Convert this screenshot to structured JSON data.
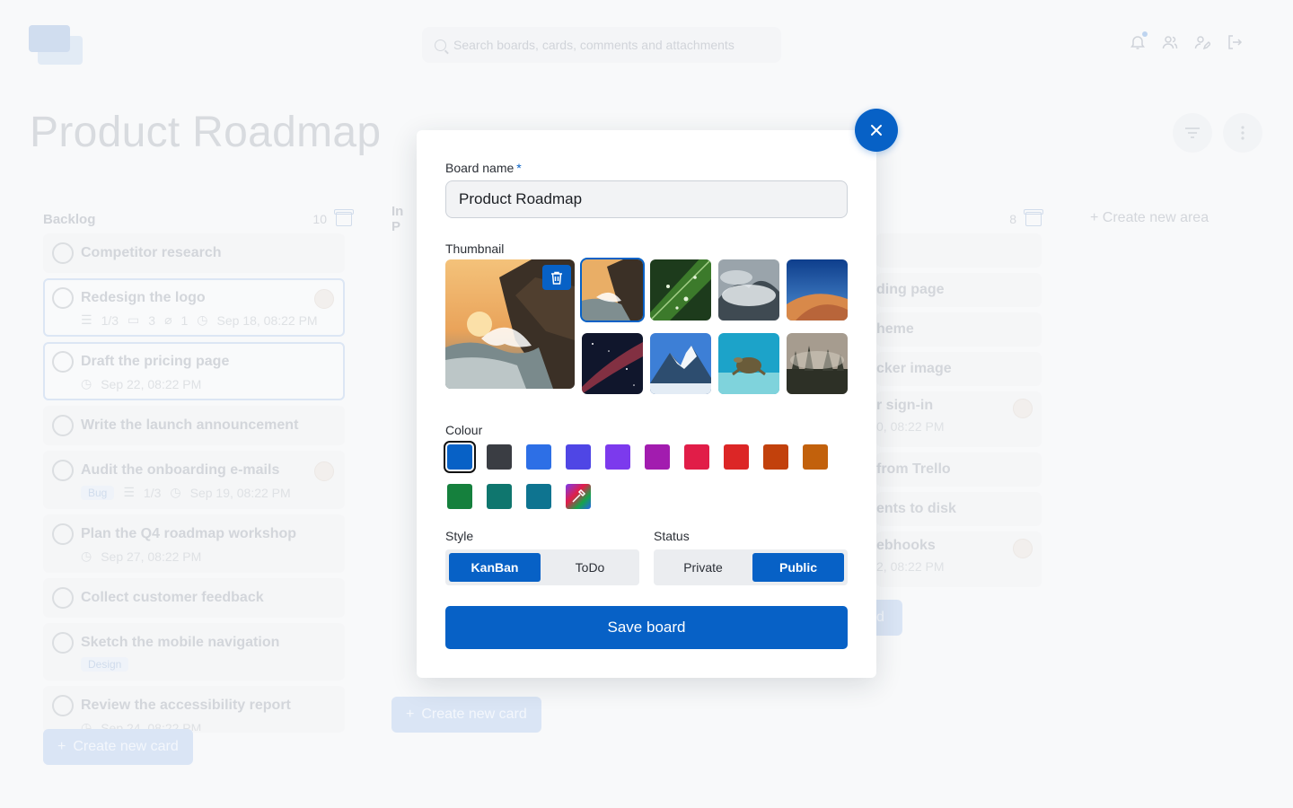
{
  "search": {
    "placeholder": "Search boards, cards, comments and attachments"
  },
  "board": {
    "title": "Product Roadmap"
  },
  "columns": [
    {
      "title": "Backlog",
      "count": "10",
      "cards": [
        {
          "title": "Competitor research"
        },
        {
          "title": "Redesign the logo",
          "checklist": "1/3",
          "comments": "3",
          "attachments": "1",
          "due": "Sep 18, 08:22 PM"
        },
        {
          "title": "Draft the pricing page",
          "due": "Sep 22, 08:22 PM"
        },
        {
          "title": "Write the launch announcement"
        },
        {
          "title": "Audit the onboarding e-mails",
          "tag": "Bug",
          "checklist": "1/3",
          "due": "Sep 19, 08:22 PM"
        },
        {
          "title": "Plan the Q4 roadmap workshop",
          "due": "Sep 27, 08:22 PM"
        },
        {
          "title": "Collect customer feedback"
        },
        {
          "title": "Sketch the mobile navigation",
          "tag": "Design"
        },
        {
          "title": "Review the accessibility report",
          "due": "Sep 24, 08:22 PM"
        }
      ],
      "create": "Create new card"
    },
    {
      "title": "In P",
      "create": "Create new card"
    },
    {
      "count": "8",
      "cards": [
        "ding page",
        "heme",
        "cker image",
        "r sign-in",
        "from Trello",
        "ents to disk",
        "ebhooks"
      ],
      "dates": [
        "0, 08:22 PM",
        "2, 08:22 PM"
      ],
      "create_partial": "d"
    }
  ],
  "create_area": "Create new area",
  "modal": {
    "board_name_label": "Board name",
    "required_mark": "*",
    "board_name_value": "Product Roadmap",
    "thumbnail_label": "Thumbnail",
    "colour_label": "Colour",
    "colours": [
      "#0761c6",
      "#3a3d43",
      "#2d6fe6",
      "#4f46e5",
      "#7c3aed",
      "#a21caf",
      "#e11d48",
      "#dc2626",
      "#c2410c",
      "#c2610c",
      "#15803d",
      "#0f766e",
      "#0e7490"
    ],
    "selected_colour": "#0761c6",
    "style_label": "Style",
    "style_options": [
      "KanBan",
      "ToDo"
    ],
    "style_selected": "KanBan",
    "status_label": "Status",
    "status_options": [
      "Private",
      "Public"
    ],
    "status_selected": "Public",
    "save_label": "Save board"
  }
}
